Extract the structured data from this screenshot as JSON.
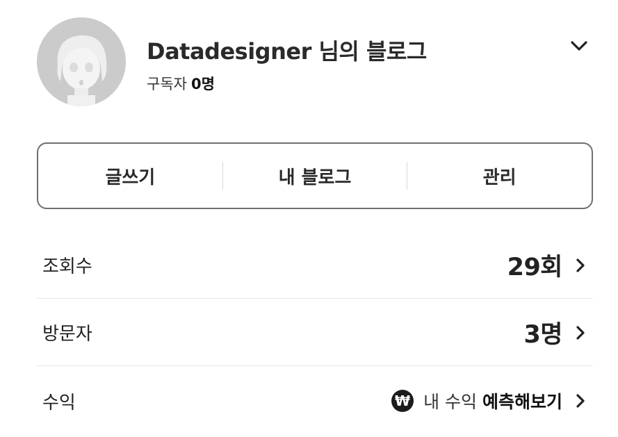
{
  "profile": {
    "blog_title": "Datadesigner 님의 블로그",
    "subscribers_label": "구독자",
    "subscribers_count": "0명"
  },
  "actions": {
    "write": "글쓰기",
    "my_blog": "내 블로그",
    "manage": "관리"
  },
  "stats": {
    "views_label": "조회수",
    "views_value": "29회",
    "visitors_label": "방문자",
    "visitors_value": "3명",
    "revenue_label": "수익",
    "revenue_icon": "₩",
    "revenue_prefix": "내 수익",
    "revenue_action": "예측해보기"
  },
  "icons": {
    "dropdown": "chevron-down-icon",
    "row_arrow": "chevron-right-icon",
    "currency": "won-icon"
  },
  "colors": {
    "text": "#222222",
    "border": "#6f6f6f",
    "divider": "#e6e6e6",
    "icon_bg": "#1c1c1c"
  }
}
